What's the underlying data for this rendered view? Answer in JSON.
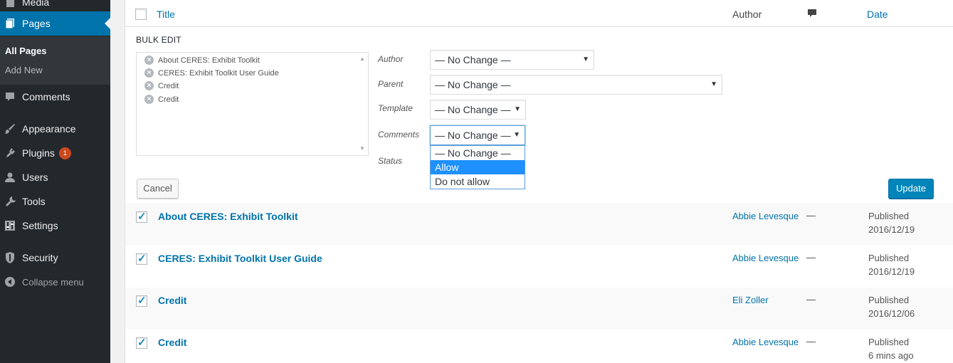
{
  "sidebar": {
    "media_label": "Media",
    "pages_label": "Pages",
    "sub_all_pages": "All Pages",
    "sub_add_new": "Add New",
    "comments_label": "Comments",
    "appearance_label": "Appearance",
    "plugins_label": "Plugins",
    "plugins_badge": "1",
    "users_label": "Users",
    "tools_label": "Tools",
    "settings_label": "Settings",
    "security_label": "Security",
    "collapse_label": "Collapse menu"
  },
  "table": {
    "col_title": "Title",
    "col_author": "Author",
    "col_date": "Date"
  },
  "bulk_edit": {
    "heading": "BULK EDIT",
    "titles": [
      "About CERES: Exhibit Toolkit",
      "CERES: Exhibit Toolkit User Guide",
      "Credit",
      "Credit"
    ],
    "author_label": "Author",
    "author_value": "— No Change —",
    "parent_label": "Parent",
    "parent_value": "— No Change —",
    "template_label": "Template",
    "template_value": "— No Change —",
    "comments_label": "Comments",
    "comments_value": "— No Change —",
    "status_label": "Status",
    "comments_options": [
      "— No Change —",
      "Allow",
      "Do not allow"
    ],
    "highlighted_option": "Allow",
    "cancel_label": "Cancel",
    "update_label": "Update"
  },
  "rows": [
    {
      "title": "About CERES: Exhibit Toolkit",
      "author": "Abbie Levesque",
      "comments": "—",
      "status": "Published",
      "date": "2016/12/19"
    },
    {
      "title": "CERES: Exhibit Toolkit User Guide",
      "author": "Abbie Levesque",
      "comments": "—",
      "status": "Published",
      "date": "2016/12/19"
    },
    {
      "title": "Credit",
      "author": "Eli Zoller",
      "comments": "—",
      "status": "Published",
      "date": "2016/12/06"
    },
    {
      "title": "Credit",
      "author": "Abbie Levesque",
      "comments": "—",
      "status": "Published",
      "date": "6 mins ago"
    }
  ],
  "colors": {
    "sidebar_bg": "#23282d",
    "accent": "#0073aa",
    "button_primary": "#0085ba",
    "highlight": "#1e90ff",
    "badge": "#ca4a1f"
  }
}
